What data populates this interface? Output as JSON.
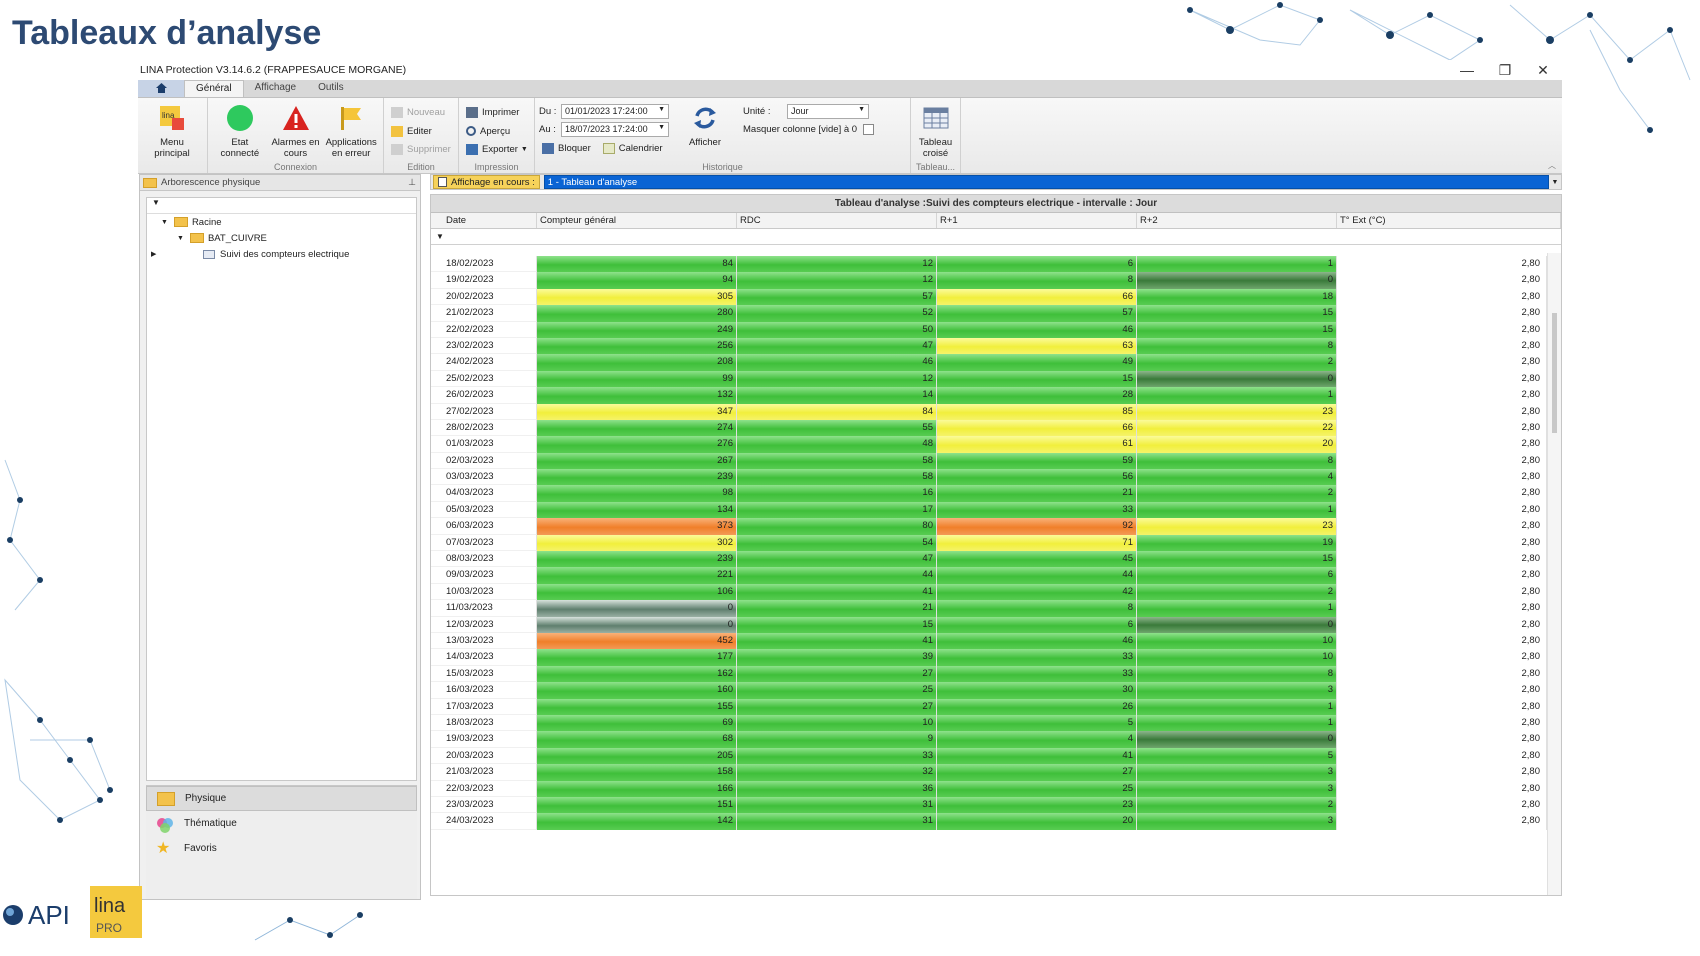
{
  "slide": {
    "title": "Tableaux d’analyse"
  },
  "window": {
    "title": "LINA Protection  V3.14.6.2  (FRAPPESAUCE MORGANE)",
    "minimize": "—",
    "restore": "❐",
    "close": "✕"
  },
  "tabs": [
    {
      "label": "Général"
    },
    {
      "label": "Affichage"
    },
    {
      "label": "Outils"
    }
  ],
  "ribbon": {
    "menu_principal": "Menu principal",
    "connexion": {
      "etat_connecte": "Etat connecté",
      "alarmes": "Alarmes en cours",
      "applications": "Applications en erreur",
      "label": "Connexion"
    },
    "edition": {
      "nouveau": "Nouveau",
      "editer": "Editer",
      "supprimer": "Supprimer",
      "label": "Edition"
    },
    "impression": {
      "imprimer": "Imprimer",
      "apercu": "Aperçu",
      "exporter": "Exporter",
      "label": "Impression"
    },
    "historique": {
      "du_label": "Du :",
      "du_value": "01/01/2023 17:24:00",
      "au_label": "Au :",
      "au_value": "18/07/2023 17:24:00",
      "bloquer": "Bloquer",
      "calendrier": "Calendrier",
      "afficher": "Afficher",
      "unite_label": "Unité :",
      "unite_value": "Jour",
      "masquer": "Masquer colonne [vide] à 0",
      "label": "Historique"
    },
    "tableau": {
      "tableau_croise": "Tableau croisé",
      "label": "Tableau..."
    }
  },
  "left_panel": {
    "title": "Arborescence physique",
    "tree": [
      {
        "label": "Racine"
      },
      {
        "label": "BAT_CUIVRE"
      },
      {
        "label": "Suivi des compteurs electrique"
      }
    ],
    "nav": [
      {
        "label": "Physique"
      },
      {
        "label": "Thématique"
      },
      {
        "label": "Favoris"
      }
    ]
  },
  "doc": {
    "current_label": "Affichage en cours :",
    "selected": "1 - Tableau d'analyse"
  },
  "grid": {
    "title": "Tableau d'analyse :Suivi des compteurs electrique - intervalle : Jour",
    "columns": [
      "Date",
      "Compteur général",
      "RDC",
      "R+1",
      "R+2",
      "T° Ext (°C)"
    ],
    "colors": {
      "green": "#3fbf3a",
      "yellow": "#f1ef3c",
      "orange": "#f07f2a",
      "dark": "#3a7a3a",
      "slate": "#5f7f6e"
    },
    "rows": [
      [
        "18/02/2023",
        "84",
        "12",
        "6",
        "1",
        "2,80",
        "green",
        "green",
        "green",
        "green"
      ],
      [
        "19/02/2023",
        "94",
        "12",
        "8",
        "0",
        "2,80",
        "green",
        "green",
        "green",
        "dark"
      ],
      [
        "20/02/2023",
        "305",
        "57",
        "66",
        "18",
        "2,80",
        "yellow",
        "green",
        "yellow",
        "green"
      ],
      [
        "21/02/2023",
        "280",
        "52",
        "57",
        "15",
        "2,80",
        "green",
        "green",
        "green",
        "green"
      ],
      [
        "22/02/2023",
        "249",
        "50",
        "46",
        "15",
        "2,80",
        "green",
        "green",
        "green",
        "green"
      ],
      [
        "23/02/2023",
        "256",
        "47",
        "63",
        "8",
        "2,80",
        "green",
        "green",
        "yellow",
        "green"
      ],
      [
        "24/02/2023",
        "208",
        "46",
        "49",
        "2",
        "2,80",
        "green",
        "green",
        "green",
        "green"
      ],
      [
        "25/02/2023",
        "99",
        "12",
        "15",
        "0",
        "2,80",
        "green",
        "green",
        "green",
        "dark"
      ],
      [
        "26/02/2023",
        "132",
        "14",
        "28",
        "1",
        "2,80",
        "green",
        "green",
        "green",
        "green"
      ],
      [
        "27/02/2023",
        "347",
        "84",
        "85",
        "23",
        "2,80",
        "yellow",
        "yellow",
        "yellow",
        "yellow"
      ],
      [
        "28/02/2023",
        "274",
        "55",
        "66",
        "22",
        "2,80",
        "green",
        "green",
        "yellow",
        "yellow"
      ],
      [
        "01/03/2023",
        "276",
        "48",
        "61",
        "20",
        "2,80",
        "green",
        "green",
        "yellow",
        "yellow"
      ],
      [
        "02/03/2023",
        "267",
        "58",
        "59",
        "8",
        "2,80",
        "green",
        "green",
        "green",
        "green"
      ],
      [
        "03/03/2023",
        "239",
        "58",
        "56",
        "4",
        "2,80",
        "green",
        "green",
        "green",
        "green"
      ],
      [
        "04/03/2023",
        "98",
        "16",
        "21",
        "2",
        "2,80",
        "green",
        "green",
        "green",
        "green"
      ],
      [
        "05/03/2023",
        "134",
        "17",
        "33",
        "1",
        "2,80",
        "green",
        "green",
        "green",
        "green"
      ],
      [
        "06/03/2023",
        "373",
        "80",
        "92",
        "23",
        "2,80",
        "orange",
        "green",
        "orange",
        "yellow"
      ],
      [
        "07/03/2023",
        "302",
        "54",
        "71",
        "19",
        "2,80",
        "yellow",
        "green",
        "yellow",
        "green"
      ],
      [
        "08/03/2023",
        "239",
        "47",
        "45",
        "15",
        "2,80",
        "green",
        "green",
        "green",
        "green"
      ],
      [
        "09/03/2023",
        "221",
        "44",
        "44",
        "6",
        "2,80",
        "green",
        "green",
        "green",
        "green"
      ],
      [
        "10/03/2023",
        "106",
        "41",
        "42",
        "2",
        "2,80",
        "green",
        "green",
        "green",
        "green"
      ],
      [
        "11/03/2023",
        "0",
        "21",
        "8",
        "1",
        "2,80",
        "slate",
        "green",
        "green",
        "green"
      ],
      [
        "12/03/2023",
        "0",
        "15",
        "6",
        "0",
        "2,80",
        "slate",
        "green",
        "green",
        "dark"
      ],
      [
        "13/03/2023",
        "452",
        "41",
        "46",
        "10",
        "2,80",
        "orange",
        "green",
        "green",
        "green"
      ],
      [
        "14/03/2023",
        "177",
        "39",
        "33",
        "10",
        "2,80",
        "green",
        "green",
        "green",
        "green"
      ],
      [
        "15/03/2023",
        "162",
        "27",
        "33",
        "8",
        "2,80",
        "green",
        "green",
        "green",
        "green"
      ],
      [
        "16/03/2023",
        "160",
        "25",
        "30",
        "3",
        "2,80",
        "green",
        "green",
        "green",
        "green"
      ],
      [
        "17/03/2023",
        "155",
        "27",
        "26",
        "1",
        "2,80",
        "green",
        "green",
        "green",
        "green"
      ],
      [
        "18/03/2023",
        "69",
        "10",
        "5",
        "1",
        "2,80",
        "green",
        "green",
        "green",
        "green"
      ],
      [
        "19/03/2023",
        "68",
        "9",
        "4",
        "0",
        "2,80",
        "green",
        "green",
        "green",
        "dark"
      ],
      [
        "20/03/2023",
        "205",
        "33",
        "41",
        "5",
        "2,80",
        "green",
        "green",
        "green",
        "green"
      ],
      [
        "21/03/2023",
        "158",
        "32",
        "27",
        "3",
        "2,80",
        "green",
        "green",
        "green",
        "green"
      ],
      [
        "22/03/2023",
        "166",
        "36",
        "25",
        "3",
        "2,80",
        "green",
        "green",
        "green",
        "green"
      ],
      [
        "23/03/2023",
        "151",
        "31",
        "23",
        "2",
        "2,80",
        "green",
        "green",
        "green",
        "green"
      ],
      [
        "24/03/2023",
        "142",
        "31",
        "20",
        "3",
        "2,80",
        "green",
        "green",
        "green",
        "green"
      ]
    ]
  },
  "logos": {
    "api": "API",
    "lina": "lina",
    "pro": "PRO"
  }
}
